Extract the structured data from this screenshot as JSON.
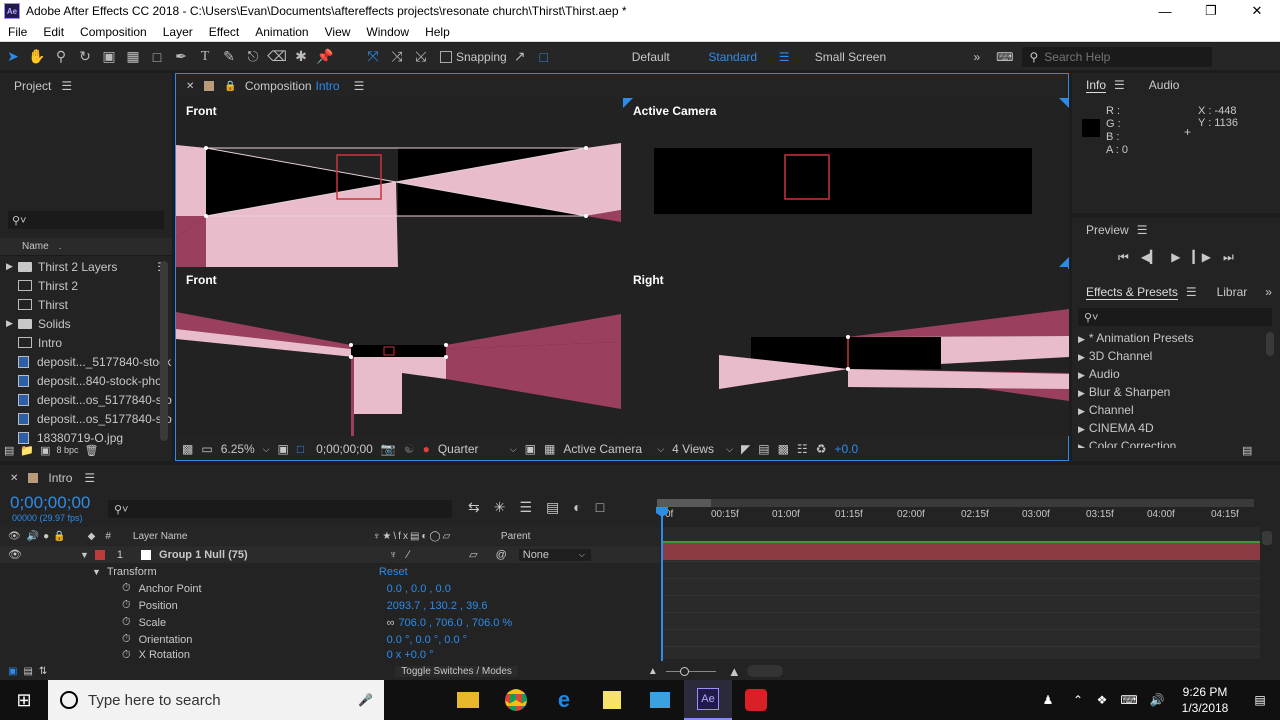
{
  "window": {
    "title": "Adobe After Effects CC 2018 - C:\\Users\\Evan\\Documents\\aftereffects projects\\resonate church\\Thirst\\Thirst.aep *",
    "app_icon": "Ae"
  },
  "menu": [
    "File",
    "Edit",
    "Composition",
    "Layer",
    "Effect",
    "Animation",
    "View",
    "Window",
    "Help"
  ],
  "toolbar": {
    "snapping_label": "Snapping",
    "workspaces": [
      "Default",
      "Standard",
      "Small Screen"
    ],
    "search_placeholder": "Search Help"
  },
  "project": {
    "title": "Project",
    "search_placeholder": "",
    "column_name": "Name",
    "items": [
      {
        "name": "Thirst 2 Layers",
        "type": "folder"
      },
      {
        "name": "Thirst 2",
        "type": "comp"
      },
      {
        "name": "Thirst",
        "type": "comp"
      },
      {
        "name": "Solids",
        "type": "folder"
      },
      {
        "name": "Intro",
        "type": "comp"
      },
      {
        "name": "deposit..._5177840-stock",
        "type": "image"
      },
      {
        "name": "deposit...840-stock-phot",
        "type": "image"
      },
      {
        "name": "deposit...os_5177840-sto",
        "type": "image"
      },
      {
        "name": "deposit...os_5177840-sto",
        "type": "image"
      },
      {
        "name": "18380719-O.jpg",
        "type": "image"
      }
    ],
    "bpc": "8 bpc"
  },
  "composition": {
    "tab_label": "Composition",
    "tab_name": "Intro",
    "views": [
      "Front",
      "Active Camera",
      "Front",
      "Right"
    ],
    "footer": {
      "zoom": "6.25%",
      "timecode": "0;00;00;00",
      "resolution": "Quarter",
      "camera": "Active Camera",
      "layout": "4 Views",
      "exposure": "+0.0"
    }
  },
  "info": {
    "tabs": [
      "Info",
      "Audio"
    ],
    "r": "R :",
    "g": "G :",
    "b": "B :",
    "a": "A : 0",
    "x": "X : -448",
    "y": "Y : 1136"
  },
  "preview": {
    "title": "Preview"
  },
  "effects": {
    "tabs": [
      "Effects & Presets",
      "Librar"
    ],
    "items": [
      "* Animation Presets",
      "3D Channel",
      "Audio",
      "Blur & Sharpen",
      "Channel",
      "CINEMA 4D",
      "Color Correction"
    ]
  },
  "timeline": {
    "tab": "Intro",
    "timecode": "0;00;00;00",
    "frames": "00000 (29.97 fps)",
    "headers": {
      "num": "#",
      "layer_name": "Layer Name",
      "parent": "Parent"
    },
    "layer": {
      "num": "1",
      "name": "Group 1 Null (75)",
      "parent": "None"
    },
    "transform": {
      "label": "Transform",
      "reset": "Reset"
    },
    "properties": [
      {
        "name": "Anchor Point",
        "value": "0.0 , 0.0 , 0.0"
      },
      {
        "name": "Position",
        "value": "2093.7 , 130.2 , 39.6"
      },
      {
        "name": "Scale",
        "value": "706.0 , 706.0 , 706.0 %"
      },
      {
        "name": "Orientation",
        "value": "0.0 °, 0.0 °, 0.0 °"
      },
      {
        "name": "X Rotation",
        "value": "0 x +0.0 °"
      }
    ],
    "ruler": [
      "0f",
      "00:15f",
      "01:00f",
      "01:15f",
      "02:00f",
      "02:15f",
      "03:00f",
      "03:15f",
      "04:00f",
      "04:15f"
    ],
    "toggle_label": "Toggle Switches / Modes"
  },
  "taskbar": {
    "search_placeholder": "Type here to search",
    "time": "9:26 PM",
    "date": "1/3/2018"
  }
}
